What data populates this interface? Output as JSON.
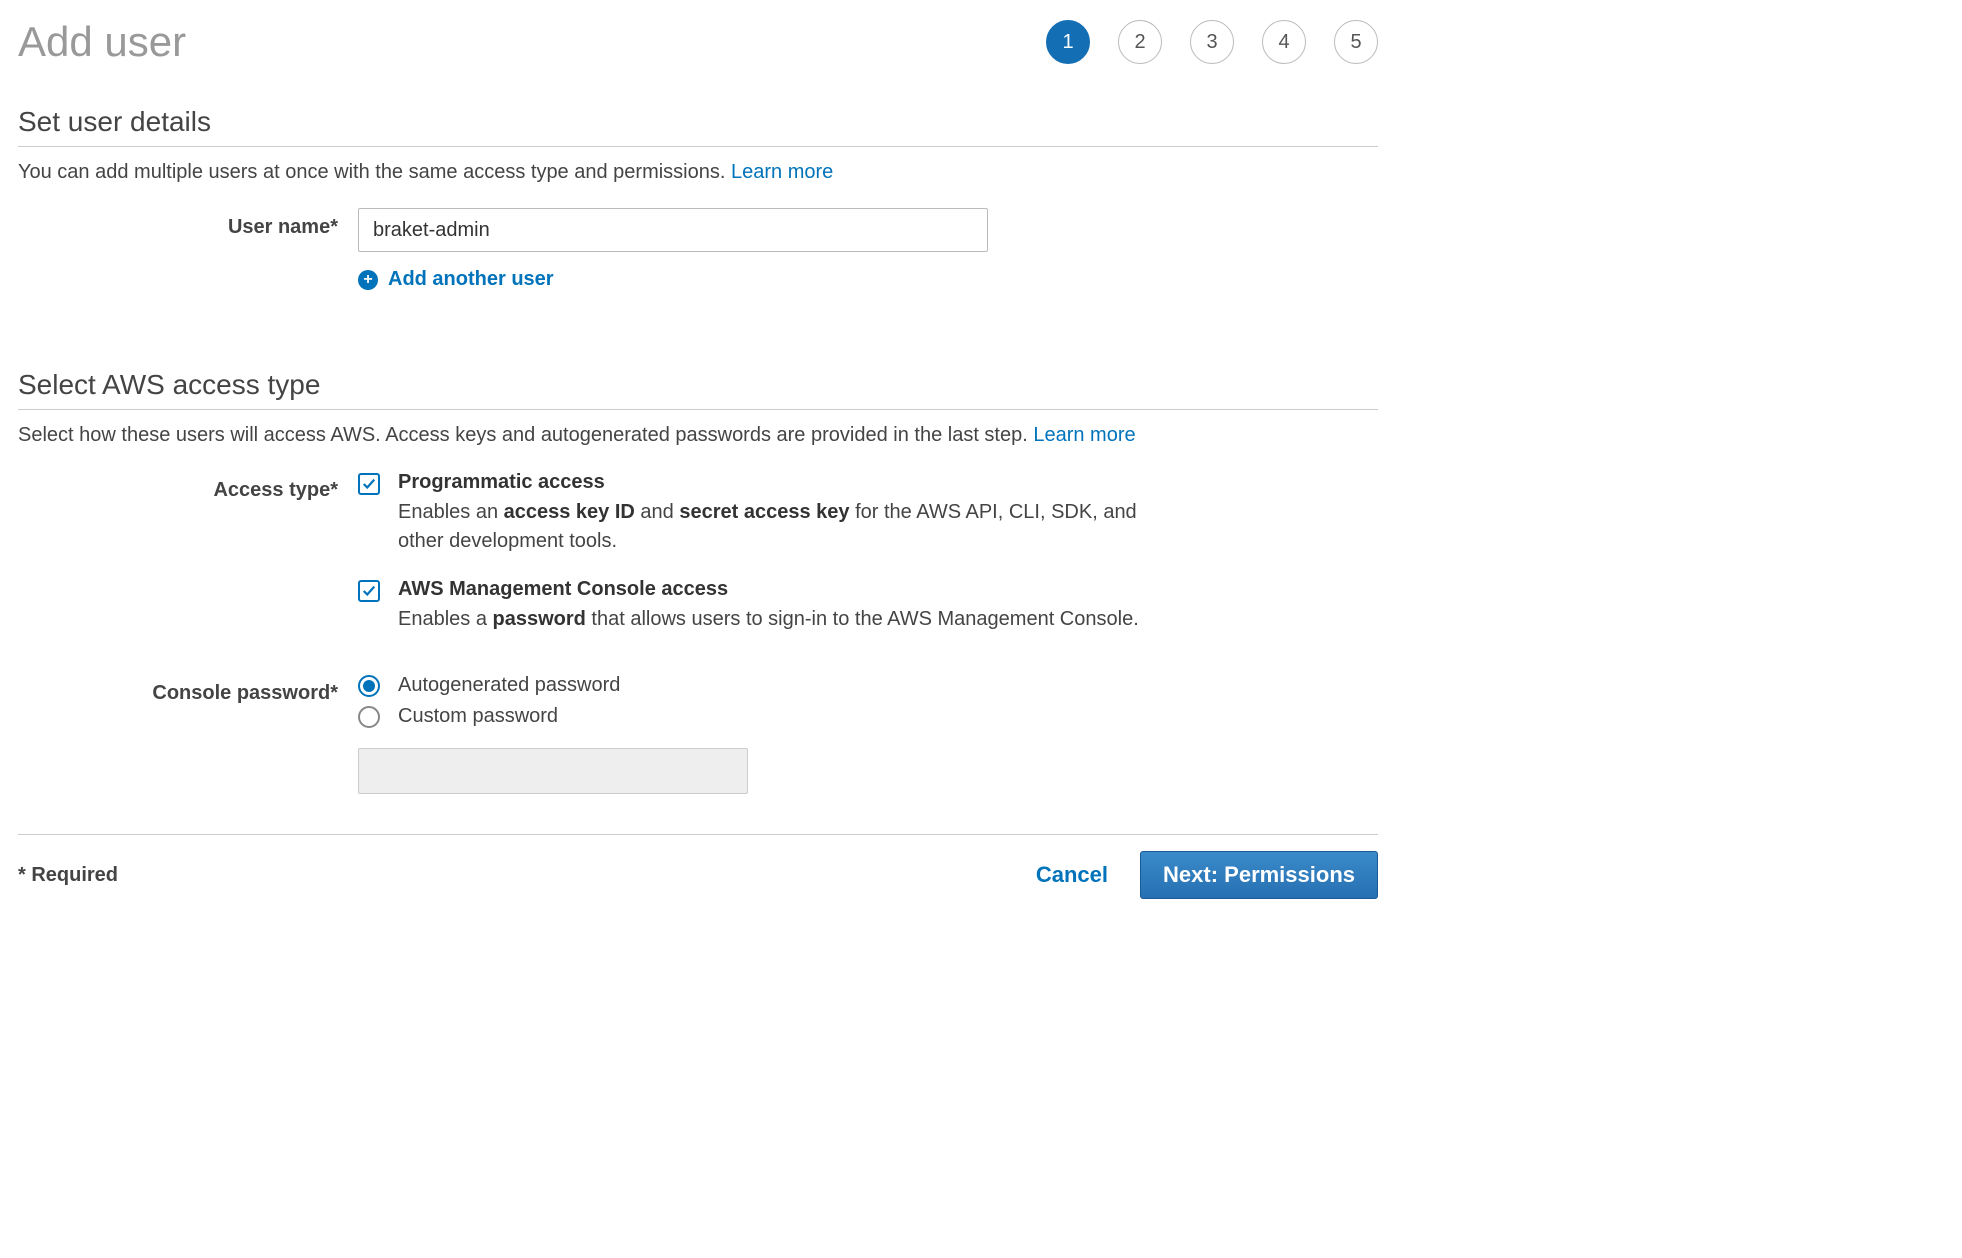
{
  "page_title": "Add user",
  "steps": [
    "1",
    "2",
    "3",
    "4",
    "5"
  ],
  "active_step": 1,
  "section1": {
    "title": "Set user details",
    "desc_prefix": "You can add multiple users at once with the same access type and permissions. ",
    "learn_more": "Learn more",
    "username_label": "User name*",
    "username_value": "braket-admin",
    "add_another": "Add another user"
  },
  "section2": {
    "title": "Select AWS access type",
    "desc_prefix": "Select how these users will access AWS. Access keys and autogenerated passwords are provided in the last step. ",
    "learn_more": "Learn more",
    "access_type_label": "Access type*",
    "programmatic": {
      "title": "Programmatic access",
      "desc_before": "Enables an ",
      "bold1": "access key ID",
      "mid": " and ",
      "bold2": "secret access key",
      "desc_after": " for the AWS API, CLI, SDK, and other development tools.",
      "checked": true
    },
    "console": {
      "title": "AWS Management Console access",
      "desc_before": "Enables a ",
      "bold1": "password",
      "desc_after": " that allows users to sign-in to the AWS Management Console.",
      "checked": true
    },
    "console_password_label": "Console password*",
    "password_options": {
      "autogen": "Autogenerated password",
      "custom": "Custom password",
      "selected": "autogen"
    }
  },
  "footer": {
    "required": "* Required",
    "cancel": "Cancel",
    "next": "Next: Permissions"
  }
}
